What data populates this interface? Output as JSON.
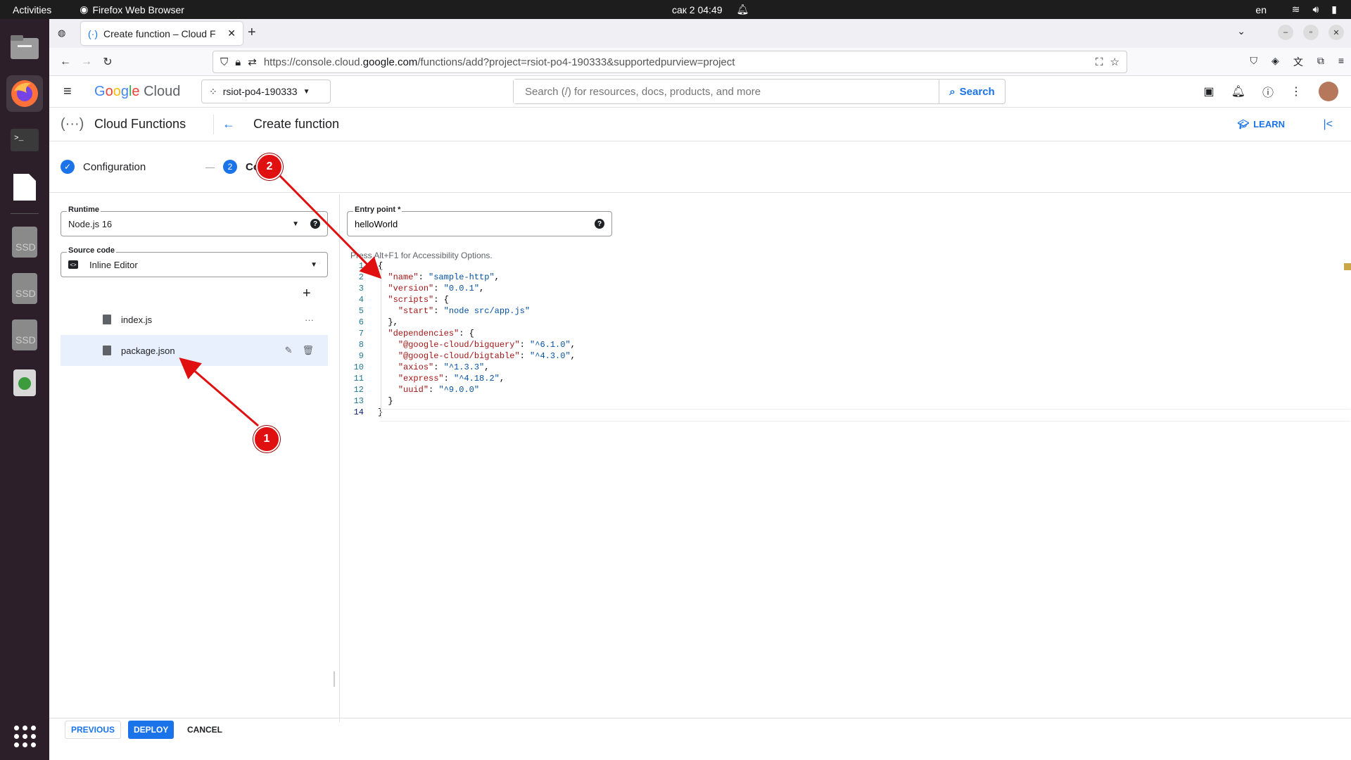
{
  "topbar": {
    "activities": "Activities",
    "app": "Firefox Web Browser",
    "clock": "сак 2  04:49",
    "lang": "en"
  },
  "browser": {
    "tab_title": "Create function – Cloud F",
    "url_prefix": "https://console.cloud.",
    "url_domain": "google.com",
    "url_suffix": "/functions/add?project=rsiot-po4-190333&supportedpurview=project"
  },
  "gcp": {
    "logo": "Google Cloud",
    "project": "rsiot-po4-190333",
    "search_placeholder": "Search (/) for resources, docs, products, and more",
    "search_button": "Search"
  },
  "page": {
    "service": "Cloud Functions",
    "title": "Create function",
    "learn": "LEARN"
  },
  "stepper": {
    "step1_label": "Configuration",
    "step2_number": "2",
    "step2_label": "Code"
  },
  "runtime": {
    "label": "Runtime",
    "value": "Node.js 16"
  },
  "source": {
    "label": "Source code",
    "value": "Inline Editor"
  },
  "entry": {
    "label": "Entry point *",
    "value": "helloWorld"
  },
  "files": [
    {
      "name": "index.js"
    },
    {
      "name": "package.json"
    }
  ],
  "editor": {
    "hint": "Press Alt+F1 for Accessibility Options.",
    "lines": [
      {
        "n": "1",
        "text": "{"
      },
      {
        "n": "2",
        "text": "  \"name\": \"sample-http\","
      },
      {
        "n": "3",
        "text": "  \"version\": \"0.0.1\","
      },
      {
        "n": "4",
        "text": "  \"scripts\": {"
      },
      {
        "n": "5",
        "text": "    \"start\": \"node src/app.js\""
      },
      {
        "n": "6",
        "text": "  },"
      },
      {
        "n": "7",
        "text": "  \"dependencies\": {"
      },
      {
        "n": "8",
        "text": "    \"@google-cloud/bigquery\": \"^6.1.0\","
      },
      {
        "n": "9",
        "text": "    \"@google-cloud/bigtable\": \"^4.3.0\","
      },
      {
        "n": "10",
        "text": "    \"axios\": \"^1.3.3\","
      },
      {
        "n": "11",
        "text": "    \"express\": \"^4.18.2\","
      },
      {
        "n": "12",
        "text": "    \"uuid\": \"^9.0.0\""
      },
      {
        "n": "13",
        "text": "  }"
      },
      {
        "n": "14",
        "text": "}"
      }
    ]
  },
  "actions": {
    "previous": "PREVIOUS",
    "deploy": "DEPLOY",
    "cancel": "CANCEL"
  },
  "annotations": {
    "badge1": "1",
    "badge2": "2",
    "color": "#e01010"
  },
  "colors": {
    "accent": "#1a73e8",
    "selected_row": "#e8f0fe"
  }
}
